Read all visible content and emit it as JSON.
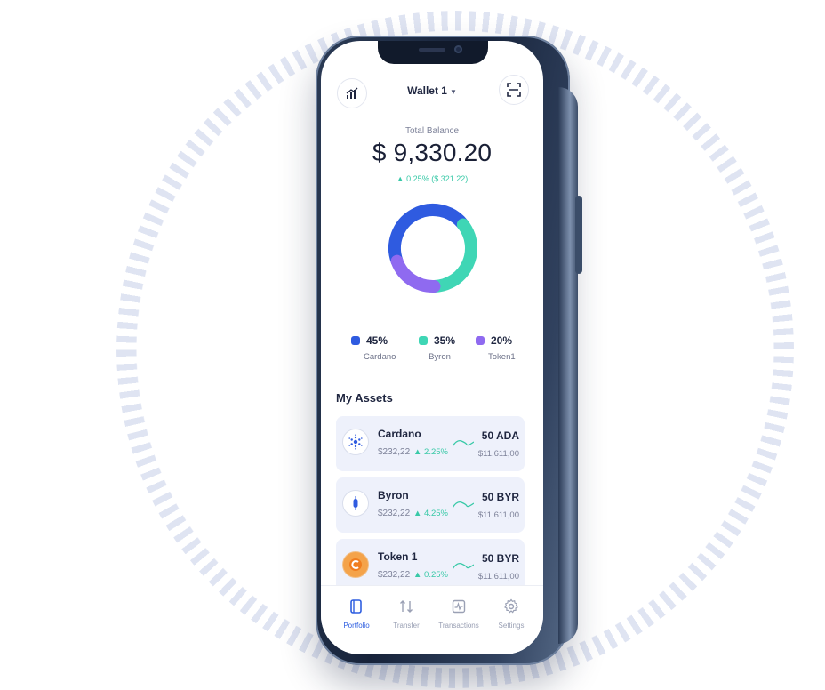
{
  "header": {
    "wallet_label": "Wallet 1",
    "left_button_icon": "chart-bar-icon",
    "right_button_icon": "qr-scan-icon"
  },
  "balance": {
    "label": "Total Balance",
    "value": "$ 9,330.20",
    "change": "▲ 0.25% ($ 321.22)"
  },
  "allocation": [
    {
      "pct": "45%",
      "name": "Cardano",
      "share": 45,
      "color": "#2f5be0"
    },
    {
      "pct": "35%",
      "name": "Byron",
      "share": 35,
      "color": "#3fd6b5"
    },
    {
      "pct": "20%",
      "name": "Token1",
      "share": 20,
      "color": "#8f6af0"
    }
  ],
  "assets": {
    "title": "My Assets",
    "items": [
      {
        "name": "Cardano",
        "price": "$232,22",
        "change": "▲ 2.25%",
        "amount": "50 ADA",
        "value": "$11.611,00",
        "icon": "cardano-icon"
      },
      {
        "name": "Byron",
        "price": "$232,22",
        "change": "▲ 4.25%",
        "amount": "50 BYR",
        "value": "$11.611,00",
        "icon": "byron-icon"
      },
      {
        "name": "Token 1",
        "price": "$232,22",
        "change": "▲ 0.25%",
        "amount": "50 BYR",
        "value": "$11.611,00",
        "icon": "token-icon"
      }
    ]
  },
  "tabs": [
    {
      "label": "Portfolio",
      "icon": "portfolio-icon",
      "active": true
    },
    {
      "label": "Transfer",
      "icon": "transfer-icon",
      "active": false
    },
    {
      "label": "Transactions",
      "icon": "transactions-icon",
      "active": false
    },
    {
      "label": "Settings",
      "icon": "gear-icon",
      "active": false
    }
  ],
  "colors": {
    "accent": "#2f5fe0",
    "positive": "#38c9a7",
    "card_bg": "#eef1fb"
  }
}
